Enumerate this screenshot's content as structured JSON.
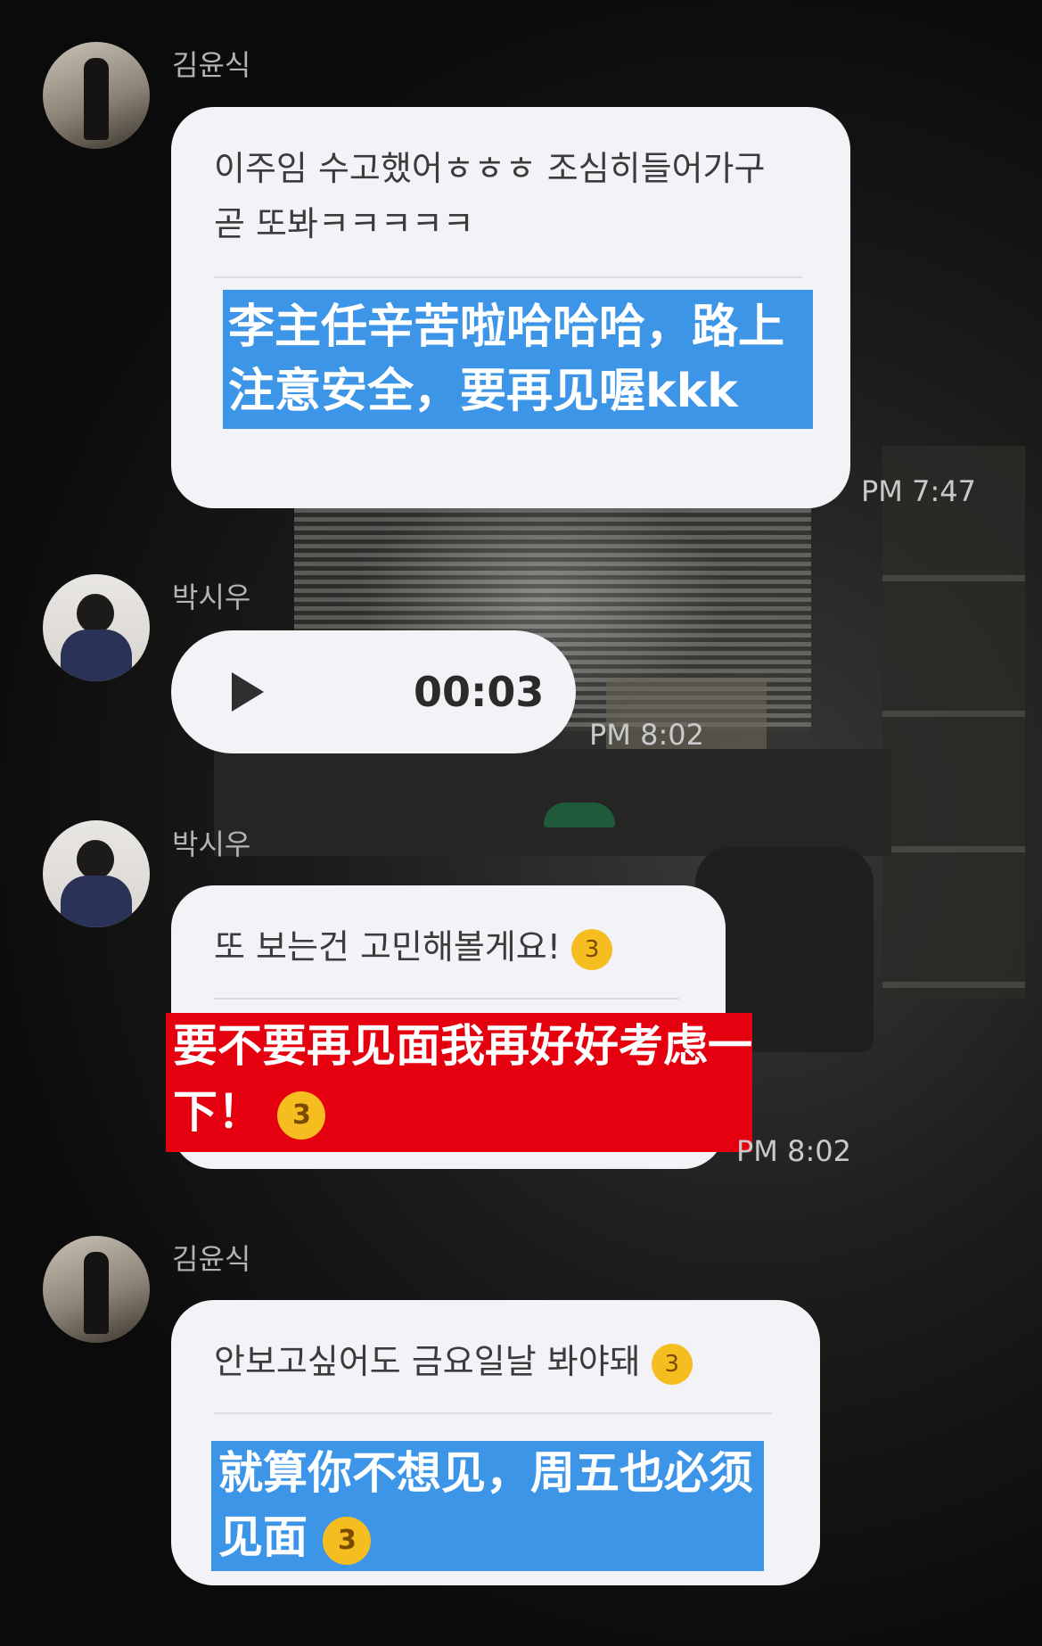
{
  "messages": [
    {
      "sender": "김윤식",
      "text": "이주임 수고했어ㅎㅎㅎ 조심히들어가구 곧 또봐ㅋㅋㅋㅋㅋ",
      "translation": "李主任辛苦啦哈哈哈，路上注意安全，要再见喔kkk",
      "time": "PM 7:47"
    },
    {
      "sender": "박시우",
      "voice_duration": "00:03",
      "time": "PM 8:02"
    },
    {
      "sender": "박시우",
      "text": "또 보는건 고민해볼게요!",
      "emoji": "kissing-face",
      "translation": "要不要再见面我再好好考虑一下！",
      "translation_emoji": "kissing-face-closed-eyes",
      "time": "PM 8:02"
    },
    {
      "sender": "김윤식",
      "text": "안보고싶어도 금요일날 봐야돼",
      "emoji": "kissing-face",
      "translation": "就算你不想见，周五也必须见面",
      "translation_emoji": "kissing-face-closed-eyes"
    }
  ],
  "colors": {
    "bubble": "#f2f2f7",
    "translation_blue": "#3d95e8",
    "translation_red": "#e4000f",
    "name_text": "#b4b4b4",
    "time_text": "#c9c9c9"
  }
}
